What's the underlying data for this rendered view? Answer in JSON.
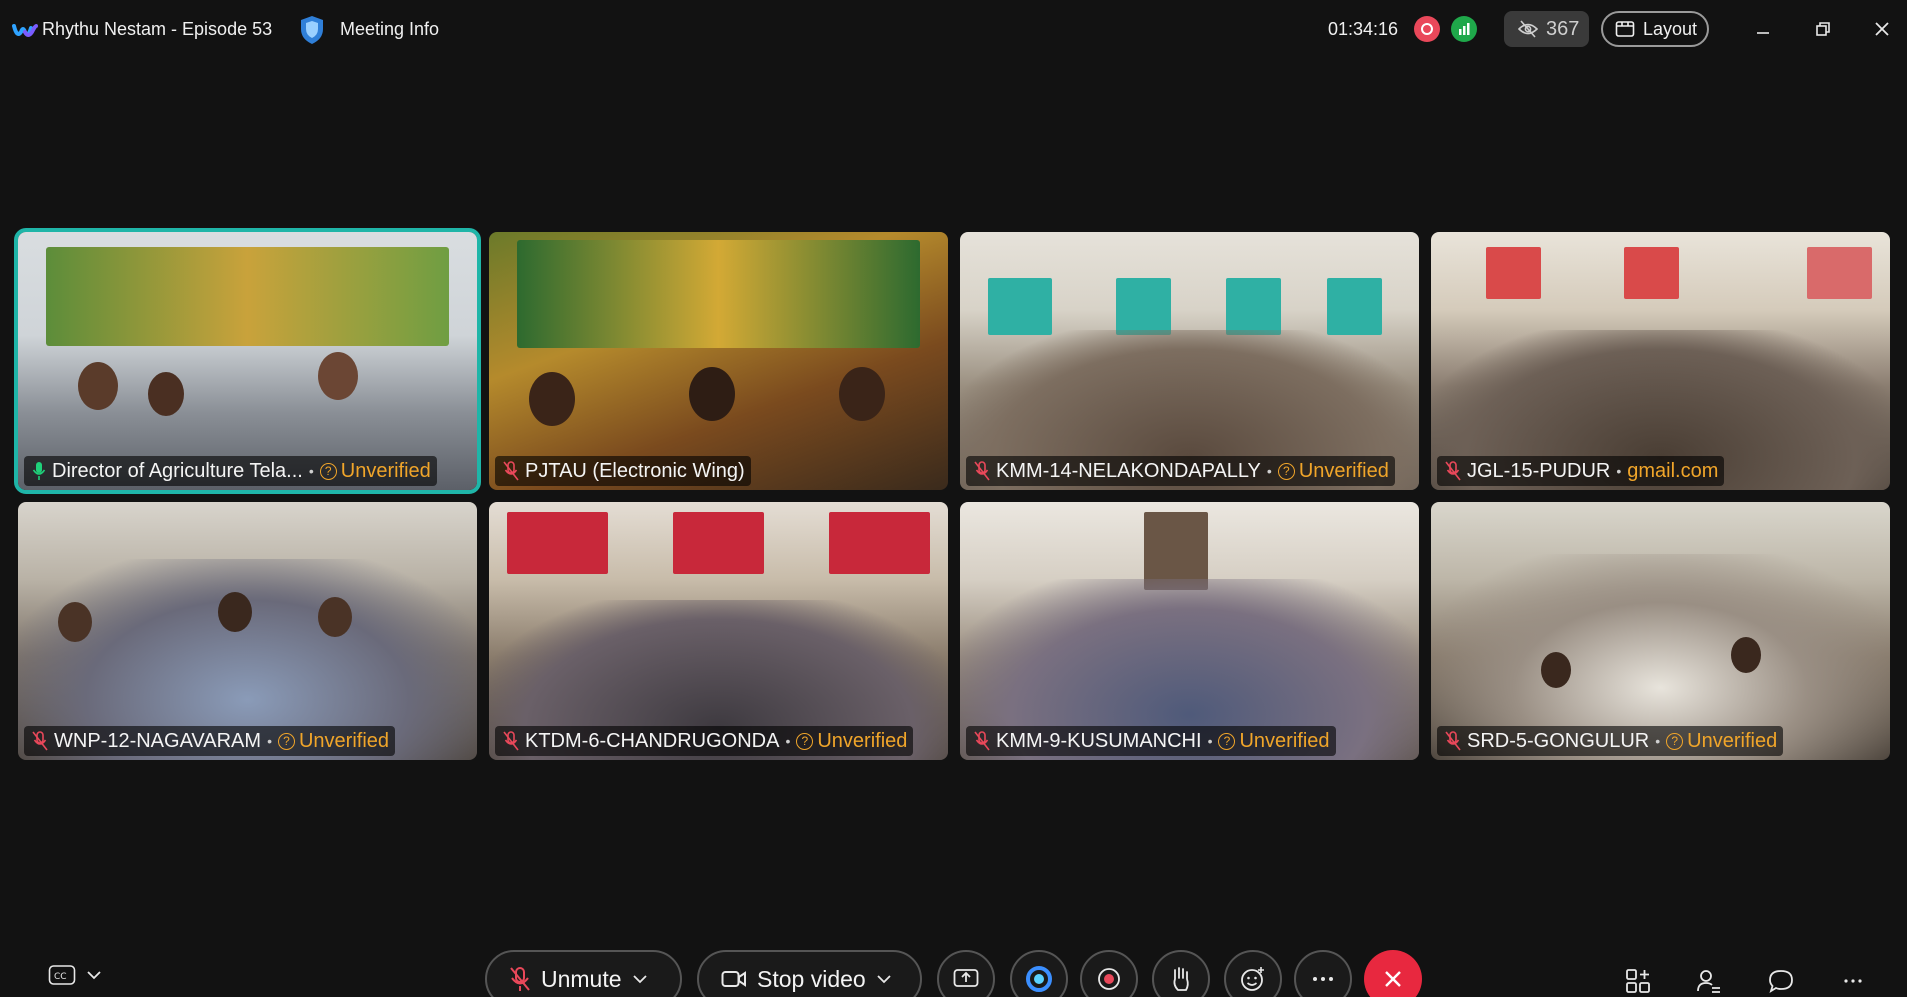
{
  "titlebar": {
    "meeting_title": "Rhythu Nestam - Episode 53",
    "meeting_info_label": "Meeting Info",
    "elapsed_time": "01:34:16",
    "hidden_participants_count": "367",
    "layout_label": "Layout"
  },
  "tiles": [
    {
      "name": "Director of Agriculture Tela...",
      "status": "Unverified",
      "mic": "on",
      "active": true
    },
    {
      "name": "PJTAU (Electronic Wing)",
      "status": "",
      "mic": "muted",
      "active": false
    },
    {
      "name": "KMM-14-NELAKONDAPALLY",
      "status": "Unverified",
      "mic": "muted",
      "active": false
    },
    {
      "name": "JGL-15-PUDUR",
      "status": "gmail.com",
      "mic": "muted",
      "active": false
    },
    {
      "name": "WNP-12-NAGAVARAM",
      "status": "Unverified",
      "mic": "muted",
      "active": false
    },
    {
      "name": "KTDM-6-CHANDRUGONDA",
      "status": "Unverified",
      "mic": "muted",
      "active": false
    },
    {
      "name": "KMM-9-KUSUMANCHI",
      "status": "Unverified",
      "mic": "muted",
      "active": false
    },
    {
      "name": "SRD-5-GONGULUR",
      "status": "Unverified",
      "mic": "muted",
      "active": false
    }
  ],
  "toolbar": {
    "unmute_label": "Unmute",
    "stop_video_label": "Stop video"
  },
  "colors": {
    "background": "#121212",
    "accent_active": "#1fb5a8",
    "end_call": "#e8283f",
    "unverified": "#f0a52a",
    "recording": "#e9485a",
    "network": "#1fa84a"
  }
}
